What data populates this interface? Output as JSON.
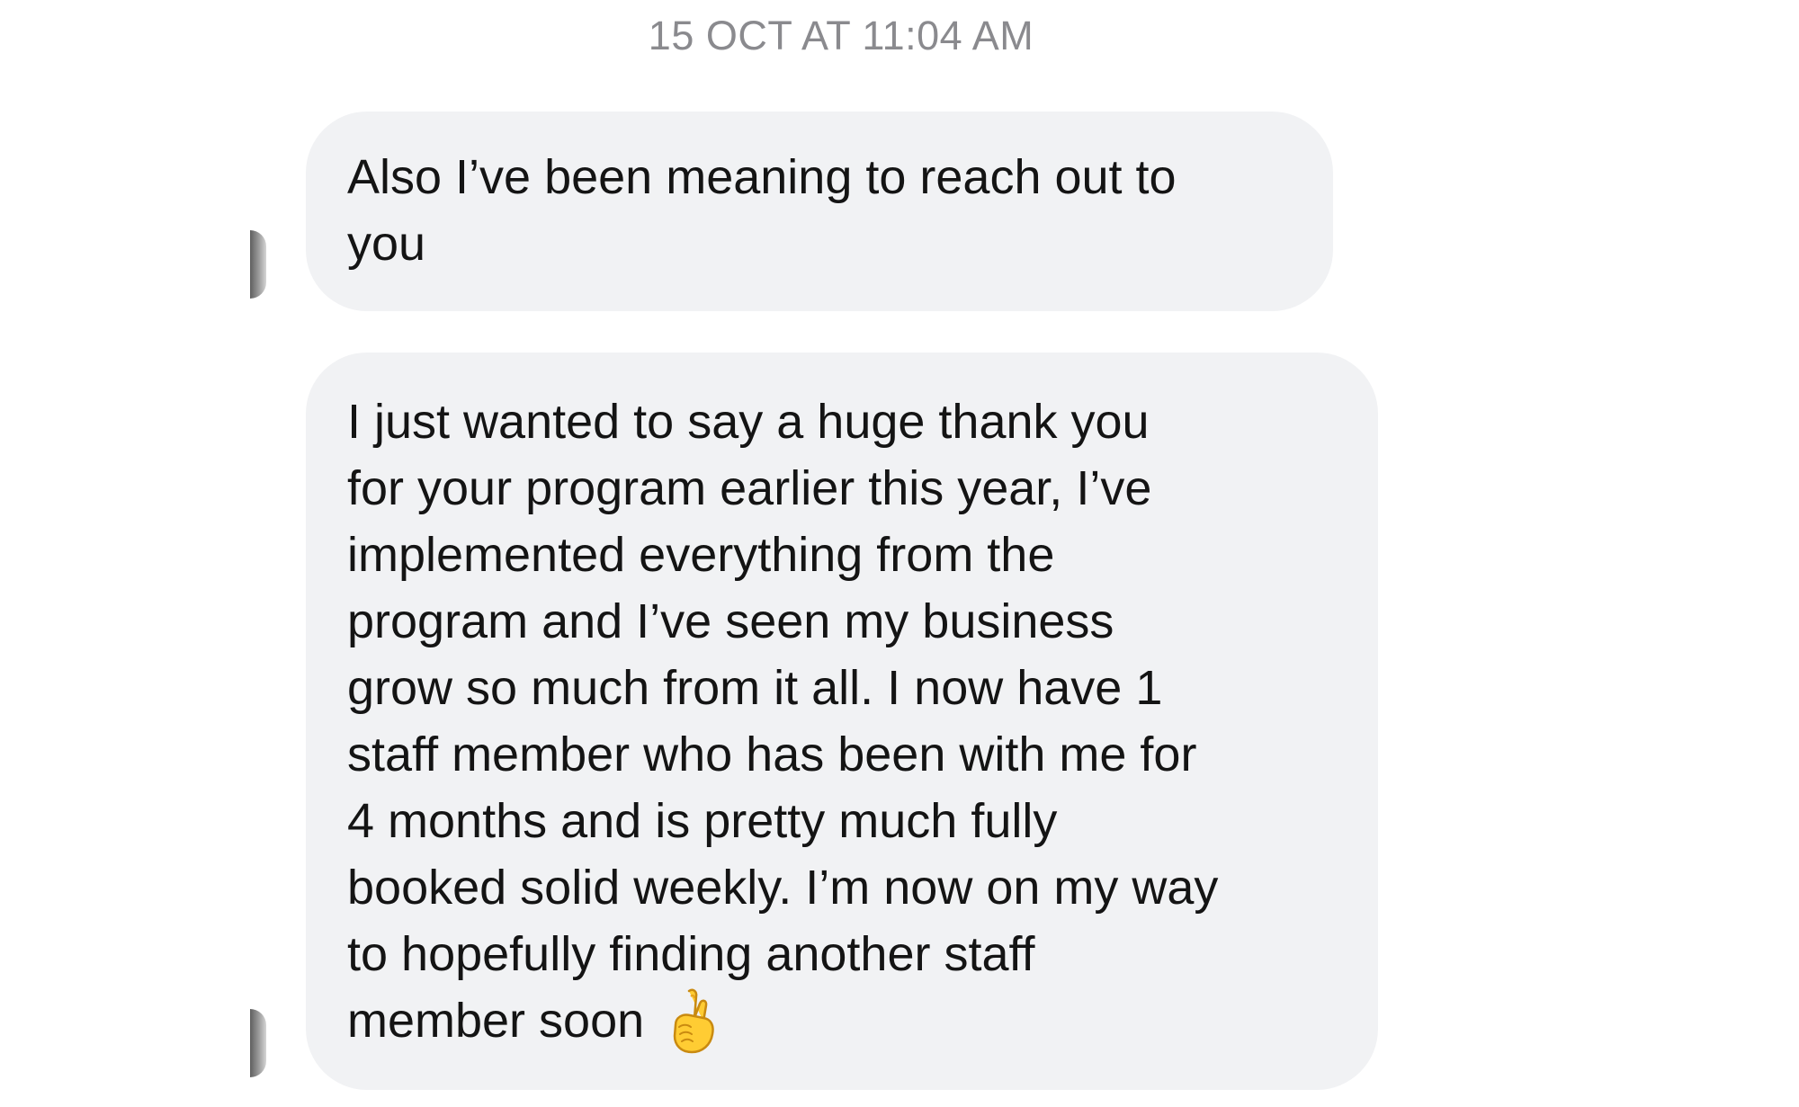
{
  "conversation": {
    "timestamp": "15 OCT AT 11:04 AM",
    "messages": [
      {
        "lines": [
          "Also I’ve been meaning to reach out to",
          "you"
        ]
      },
      {
        "lines": [
          "I just wanted to say a huge thank you",
          "for your program earlier this year, I’ve",
          "implemented everything from the",
          "program and I’ve seen my business",
          "grow so much from it all. I now have 1",
          "staff member who has been with me for",
          "4 months and is pretty much fully",
          "booked solid weekly. I’m now on my way",
          "to hopefully finding another staff",
          "member soon"
        ],
        "emoji": "crossed-fingers-icon"
      }
    ]
  }
}
